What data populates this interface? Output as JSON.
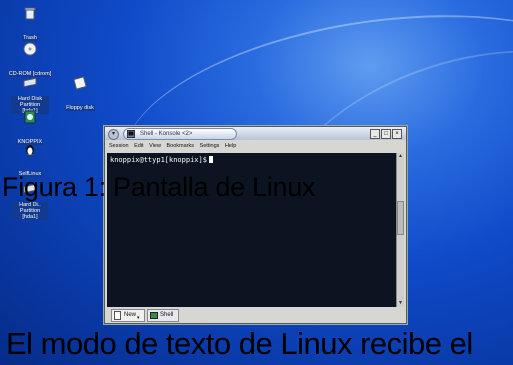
{
  "desktop": {
    "icons": [
      {
        "label": "Trash",
        "icon": "trash-icon"
      },
      {
        "label": "CD-ROM [cdrom]",
        "icon": "cdrom-icon"
      },
      {
        "label": "Hard Disk Partition [hda1]",
        "icon": "hard-disk-icon"
      },
      {
        "label": "Floppy disk",
        "icon": "floppy-icon"
      },
      {
        "label": "KNOPPIX",
        "icon": "knoppix-icon"
      },
      {
        "label": "SelfLinux",
        "icon": "tux-icon"
      },
      {
        "label": "Hard Di.. Partition [hda1]",
        "icon": "hard-disk-icon"
      }
    ]
  },
  "window": {
    "title": "Shell - Konsole <2>",
    "menu": [
      "Session",
      "Edit",
      "View",
      "Bookmarks",
      "Settings",
      "Help"
    ],
    "prompt": "knoppix@ttyp1[knoppix]$",
    "tabs": {
      "new_label": "New",
      "shell_label": "Shell"
    },
    "controls": {
      "minimize": "_",
      "maximize": "□",
      "close": "×"
    }
  },
  "overlay": {
    "figure_caption": "Figura 1: Pantalla de Linux",
    "bottom_text": "El modo de texto de Linux recibe el"
  },
  "colors": {
    "terminal_bg": "#0b1420",
    "terminal_text": "#ffffff",
    "desktop_blue": "#0f4ac8"
  }
}
